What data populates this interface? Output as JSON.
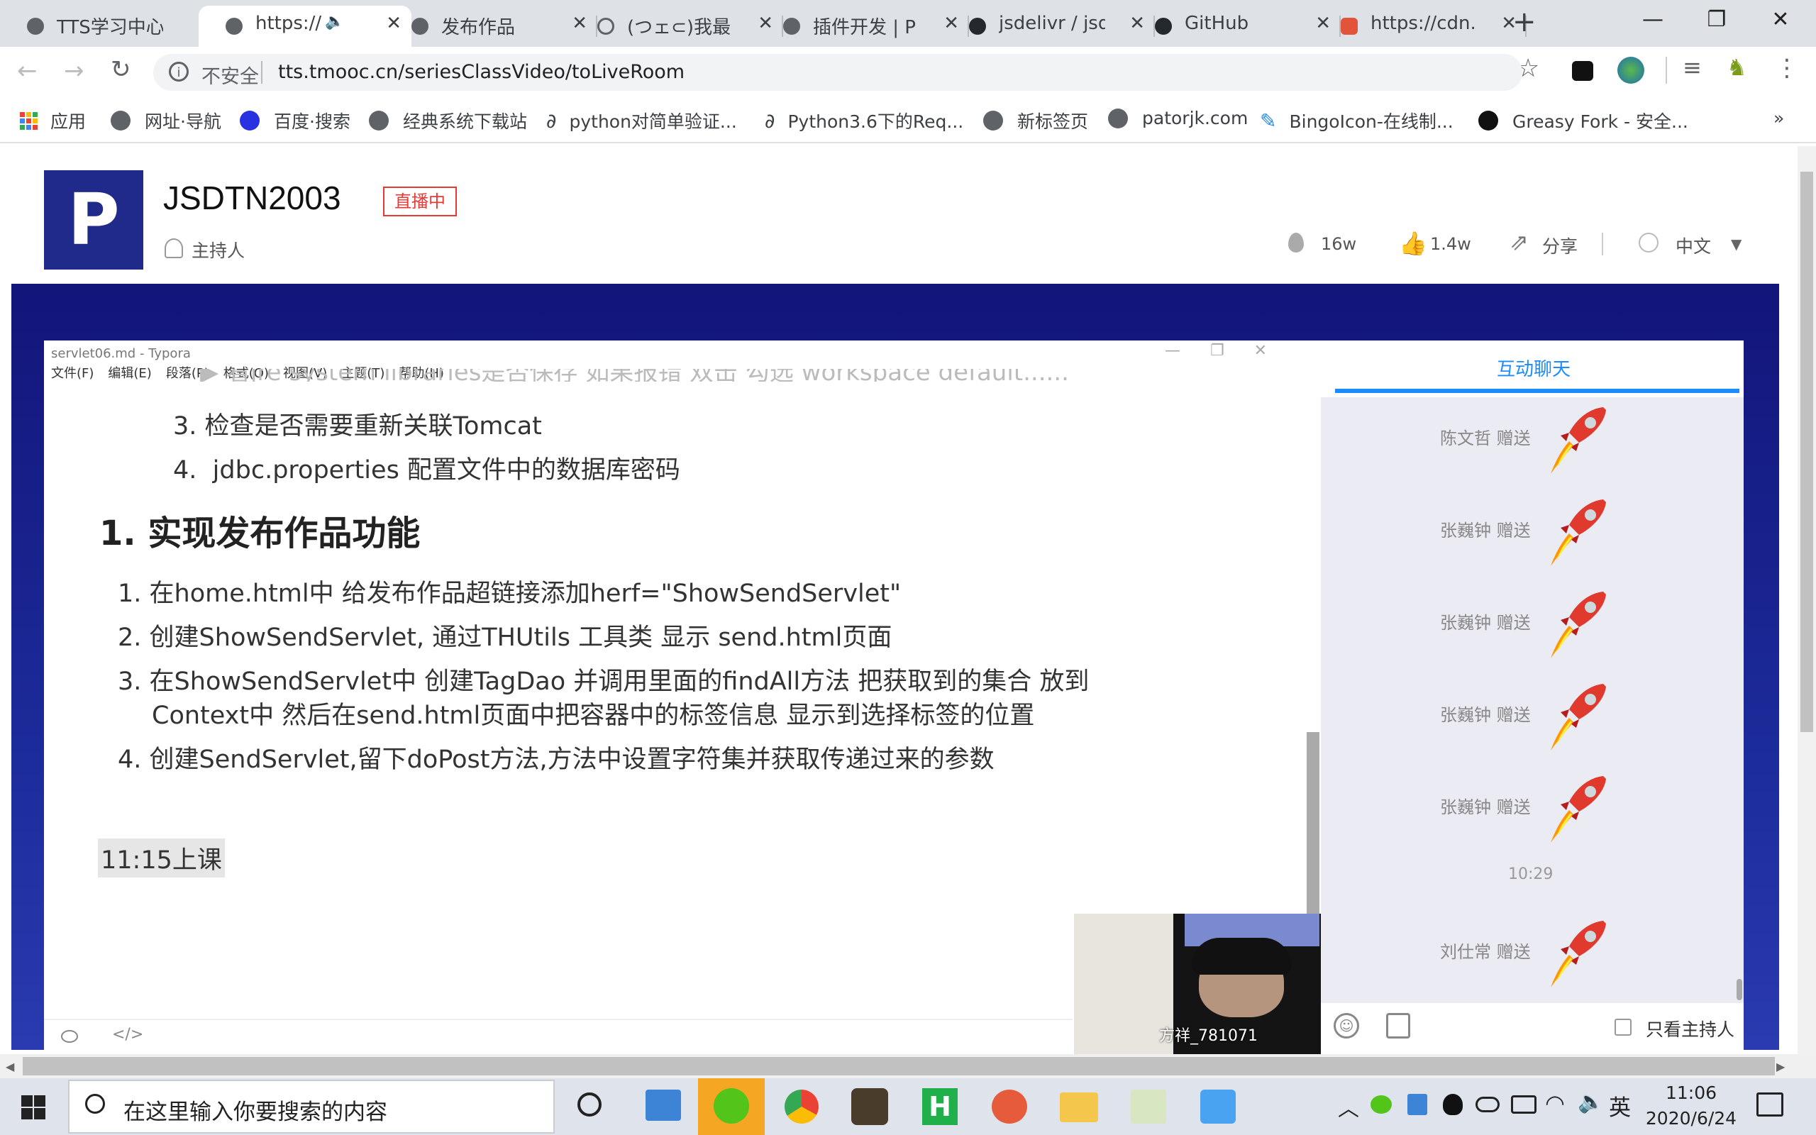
{
  "browser": {
    "tabs": [
      {
        "label": "TTS学习中心",
        "icon": "globe-icon"
      },
      {
        "label": "https://",
        "icon": "globe-icon",
        "active": true,
        "audio": true
      },
      {
        "label": "发布作品",
        "icon": "globe-icon"
      },
      {
        "label": "(つェ⊂)我最",
        "icon": "swirl-icon"
      },
      {
        "label": "插件开发 | P",
        "icon": "globe-icon"
      },
      {
        "label": "jsdelivr / jsd",
        "icon": "github-icon"
      },
      {
        "label": "GitHub",
        "icon": "github-icon"
      },
      {
        "label": "https://cdn.",
        "icon": "shield-icon"
      }
    ],
    "new_tab": "+",
    "window_controls": {
      "minimize": "—",
      "maximize": "❐",
      "close": "✕"
    },
    "address": {
      "security": "不安全",
      "url": "tts.tmooc.cn/seriesClassVideo/toLiveRoom"
    },
    "bookmarks": [
      {
        "label": "应用",
        "icon": "apps-icon"
      },
      {
        "label": "网址·导航",
        "icon": "globe-icon"
      },
      {
        "label": "百度·搜索",
        "icon": "paw-icon"
      },
      {
        "label": "经典系统下载站",
        "icon": "globe-icon"
      },
      {
        "label": "python对简单验证...",
        "icon": "tilde-icon"
      },
      {
        "label": "Python3.6下的Req...",
        "icon": "tilde-icon"
      },
      {
        "label": "新标签页",
        "icon": "globe-icon"
      },
      {
        "label": "patorjk.com",
        "icon": "globe-icon"
      },
      {
        "label": "BingoIcon-在线制...",
        "icon": "pen-icon"
      },
      {
        "label": "Greasy Fork - 安全...",
        "icon": "greasy-icon"
      }
    ],
    "bookmarks_more": "»"
  },
  "header": {
    "logo_letter": "P",
    "room_name": "JSDTN2003",
    "live_badge": "直播中",
    "host_label": "主持人",
    "stats": {
      "heat": "16w",
      "likes": "1.4w",
      "share": "分享",
      "language": "中文"
    }
  },
  "typora": {
    "title": "servlet06.md - Typora",
    "menu": [
      "文件(F)",
      "编辑(E)",
      "段落(P)",
      "格式(O)",
      "视图(V)",
      "主题(T)",
      "帮助(H)"
    ],
    "partial_line": "▶ 看jre system libraries是否保存 如果报错 双击 勾选 workspace default......",
    "sublist": [
      {
        "num": "3.",
        "text": "检查是否需要重新关联Tomcat"
      },
      {
        "num": "4.",
        "text": "jdbc.properties 配置文件中的数据库密码"
      }
    ],
    "heading": "1. 实现发布作品功能",
    "steps": [
      {
        "num": "1.",
        "text": "在home.html中 给发布作品超链接添加herf=\"ShowSendServlet\""
      },
      {
        "num": "2.",
        "text": "创建ShowSendServlet, 通过THUtils 工具类 显示 send.html页面"
      },
      {
        "num": "3.",
        "text": "在ShowSendServlet中 创建TagDao 并调用里面的findAll方法 把获取到的集合 放到",
        "text2": "Context中  然后在send.html页面中把容器中的标签信息 显示到选择标签的位置"
      },
      {
        "num": "4.",
        "text": "创建SendServlet,留下doPost方法,方法中设置字符集并获取传递过来的参数"
      }
    ],
    "note": "11:15上课"
  },
  "video": {
    "caption": "方祥_781071"
  },
  "chat": {
    "tab_label": "互动聊天",
    "items": [
      {
        "name": "陈文哲 赠送"
      },
      {
        "name": "张巍钟 赠送"
      },
      {
        "name": "张巍钟 赠送"
      },
      {
        "name": "张巍钟 赠送"
      },
      {
        "name": "张巍钟 赠送"
      }
    ],
    "time": "10:29",
    "last_item": {
      "name": "刘仕常 赠送"
    },
    "host_only_label": "只看主持人"
  },
  "taskbar": {
    "search_placeholder": "在这里输入你要搜索的内容",
    "time": "11:06",
    "date": "2020/6/24",
    "ime": "英"
  },
  "colors": {
    "live_bg": "#16208a",
    "chat_accent": "#1a8cff",
    "badge_red": "#e53935",
    "logo_bg": "#1f2a8a"
  }
}
